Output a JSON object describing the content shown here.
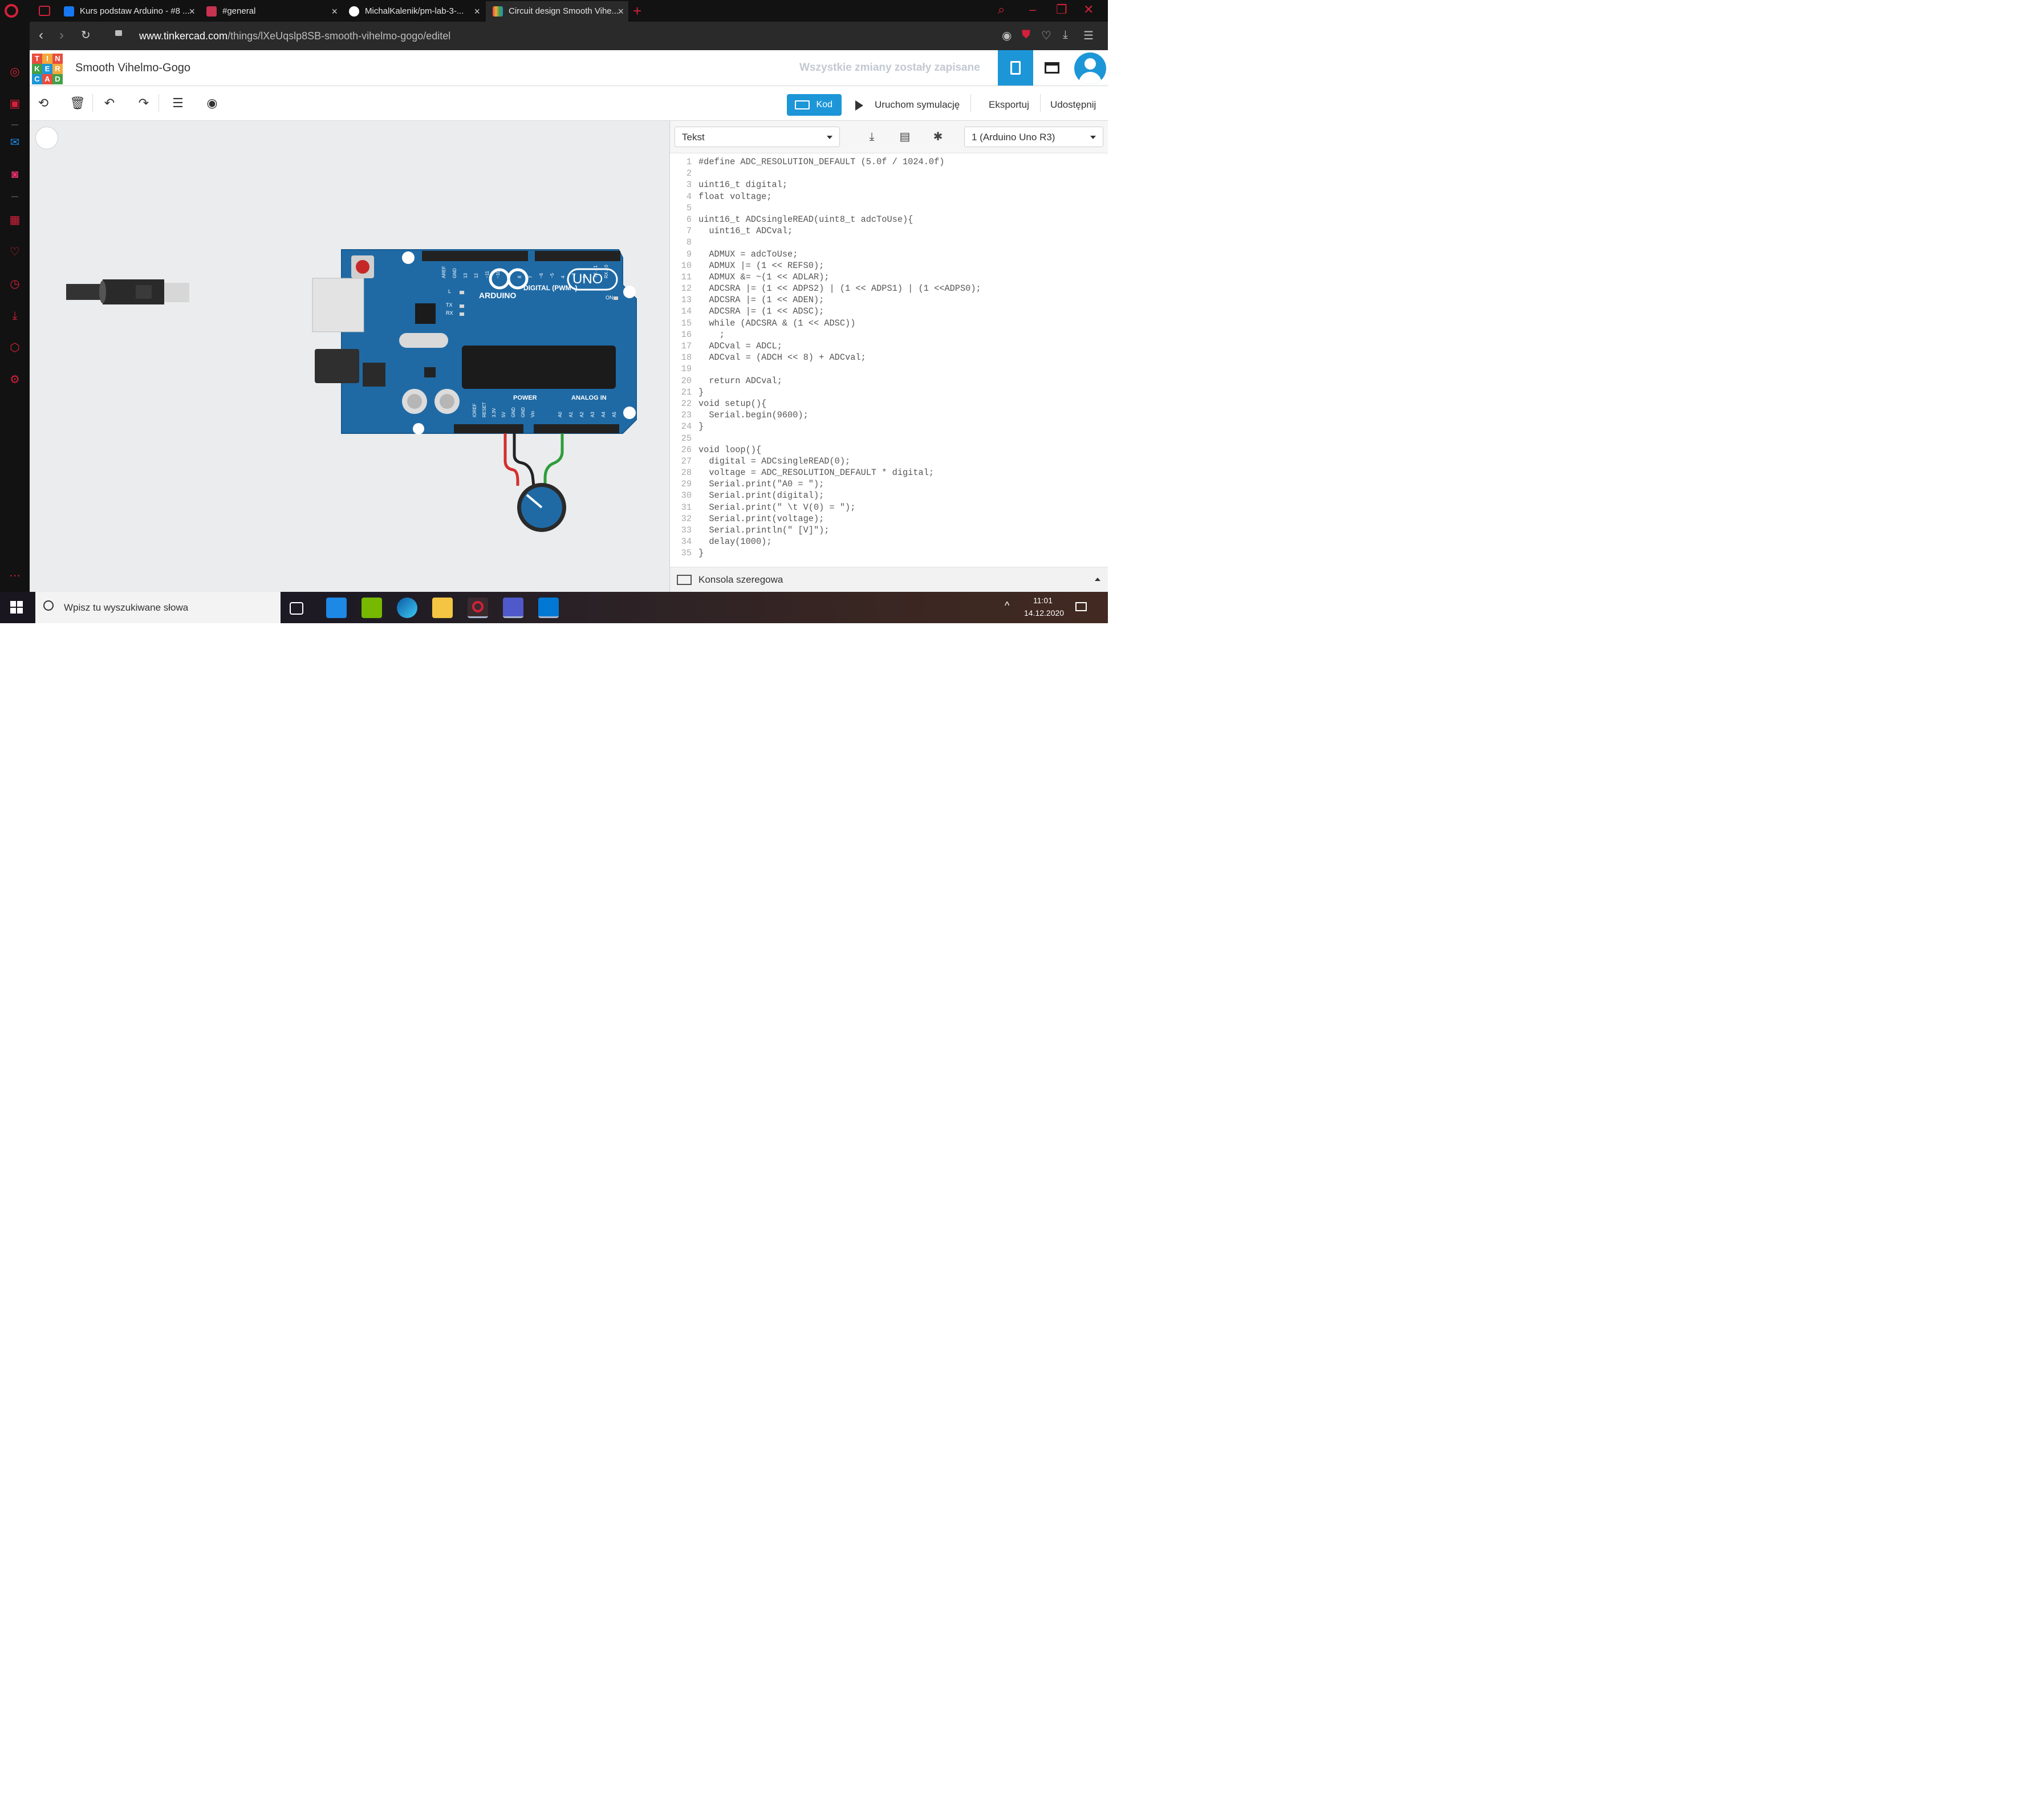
{
  "browser": {
    "tabs": [
      {
        "label": "Kurs podstaw Arduino - #8 ..."
      },
      {
        "label": "#general"
      },
      {
        "label": "MichalKalenik/pm-lab-3-..."
      },
      {
        "label": "Circuit design Smooth Vihe..."
      }
    ],
    "url_domain": "www.tinkercad.com",
    "url_path": "/things/lXeUqslp8SB-smooth-vihelmo-gogo/editel"
  },
  "tinkercad": {
    "logo_letters": [
      "T",
      "I",
      "N",
      "K",
      "E",
      "R",
      "C",
      "A",
      "D"
    ],
    "project_title": "Smooth Vihelmo-Gogo",
    "save_status": "Wszystkie zmiany zostały zapisane",
    "toolbar": {
      "code_label": "Kod",
      "simulate_label": "Uruchom symulację",
      "export_label": "Eksportuj",
      "share_label": "Udostępnij"
    },
    "code": {
      "mode": "Tekst",
      "device": "1 (Arduino Uno R3)",
      "lines": [
        "#define ADC_RESOLUTION_DEFAULT (5.0f / 1024.0f)",
        "",
        "uint16_t digital;",
        "float voltage;",
        "",
        "uint16_t ADCsingleREAD(uint8_t adcToUse){",
        "  uint16_t ADCval;",
        "",
        "  ADMUX = adcToUse;",
        "  ADMUX |= (1 << REFS0);",
        "  ADMUX &= ~(1 << ADLAR);",
        "  ADCSRA |= (1 << ADPS2) | (1 << ADPS1) | (1 <<ADPS0);",
        "  ADCSRA |= (1 << ADEN);",
        "  ADCSRA |= (1 << ADSC);",
        "  while (ADCSRA & (1 << ADSC))",
        "    ;",
        "  ADCval = ADCL;",
        "  ADCval = (ADCH << 8) + ADCval;",
        "",
        "  return ADCval;",
        "}",
        "void setup(){",
        "  Serial.begin(9600);",
        "}",
        "",
        "void loop(){",
        "  digital = ADCsingleREAD(0);",
        "  voltage = ADC_RESOLUTION_DEFAULT * digital;",
        "  Serial.print(\"A0 = \");",
        "  Serial.print(digital);",
        "  Serial.print(\" \\t V(0) = \");",
        "  Serial.print(voltage);",
        "  Serial.println(\" [V]\");",
        "  delay(1000);",
        "}"
      ],
      "serial_monitor": "Konsola szeregowa"
    },
    "board": {
      "brand": "ARDUINO",
      "model": "UNO",
      "digital_label": "DIGITAL (PWM~)",
      "power_label": "POWER",
      "analog_label": "ANALOG IN",
      "on_label": "ON",
      "led_labels": [
        "L",
        "TX",
        "RX"
      ],
      "digital_pins": [
        "AREF",
        "GND",
        "13",
        "12",
        "~11",
        "~10",
        "~9",
        "8",
        "7",
        "~6",
        "~5",
        "4",
        "~3",
        "2",
        "TX→1",
        "RX←0"
      ],
      "power_pins": [
        "IOREF",
        "RESET",
        "3.3V",
        "5V",
        "GND",
        "GND",
        "Vin"
      ],
      "analog_pins": [
        "A0",
        "A1",
        "A2",
        "A3",
        "A4",
        "A5"
      ],
      "wire_colors": {
        "vcc": "#d32f2f",
        "gnd": "#222222",
        "signal": "#2e9d3a"
      }
    }
  },
  "taskbar": {
    "search_placeholder": "Wpisz tu wyszukiwane słowa",
    "time": "11:01",
    "date": "14.12.2020"
  },
  "colors": {
    "accent": "#1d96d8",
    "board": "#1f6aa5",
    "opera_red": "#d3213a"
  }
}
